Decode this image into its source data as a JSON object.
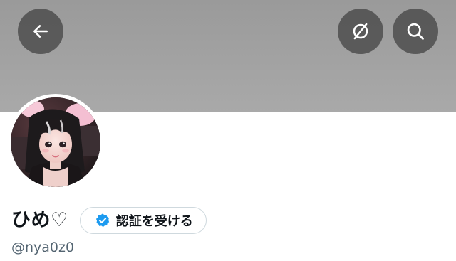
{
  "header": {
    "back_icon": "arrow-left-icon",
    "translate_icon": "translate-off-icon",
    "search_icon": "search-icon",
    "banner_color": "#a3a3a3"
  },
  "profile": {
    "display_name": "ひめ♡",
    "handle": "@nya0z0",
    "avatar": "profile-photo"
  },
  "verify": {
    "label": "認証を受ける",
    "badge_icon": "verified-badge-icon",
    "badge_color": "#1d9bf0"
  }
}
